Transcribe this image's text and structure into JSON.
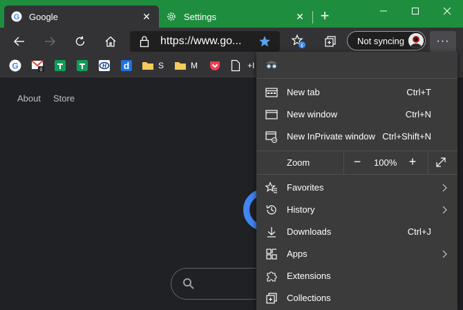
{
  "tabs": [
    {
      "label": "Google",
      "icon": "google-icon"
    },
    {
      "label": "Settings",
      "icon": "gear-icon"
    }
  ],
  "address_bar": {
    "url": "https://www.go..."
  },
  "profile": {
    "sync_label": "Not syncing"
  },
  "more_menu_label": "···",
  "favorites_bar": [
    {
      "icon": "google-icon"
    },
    {
      "icon": "gmail-icon"
    },
    {
      "icon": "sheets-icon"
    },
    {
      "icon": "sheets-icon"
    },
    {
      "icon": "hyundai-icon"
    },
    {
      "icon": "d-icon"
    },
    {
      "label": "S",
      "icon": "folder-icon"
    },
    {
      "label": "M",
      "icon": "folder-icon"
    },
    {
      "icon": "pocket-icon"
    },
    {
      "icon": "page-icon"
    },
    {
      "label": "+I",
      "icon": "page-icon"
    }
  ],
  "page": {
    "links": [
      "About",
      "Store"
    ]
  },
  "menu": {
    "items_top": [
      {
        "label": "New tab",
        "shortcut": "Ctrl+T",
        "icon": "new-tab-icon"
      },
      {
        "label": "New window",
        "shortcut": "Ctrl+N",
        "icon": "new-window-icon"
      },
      {
        "label": "New InPrivate window",
        "shortcut": "Ctrl+Shift+N",
        "icon": "inprivate-window-icon"
      }
    ],
    "zoom": {
      "label": "Zoom",
      "value": "100%",
      "minus": "−",
      "plus": "+"
    },
    "items_bottom": [
      {
        "label": "Favorites",
        "shortcut": "",
        "icon": "favorites-icon",
        "submenu": true
      },
      {
        "label": "History",
        "shortcut": "",
        "icon": "history-icon",
        "submenu": true
      },
      {
        "label": "Downloads",
        "shortcut": "Ctrl+J",
        "icon": "download-icon",
        "submenu": false
      },
      {
        "label": "Apps",
        "shortcut": "",
        "icon": "apps-icon",
        "submenu": true
      },
      {
        "label": "Extensions",
        "shortcut": "",
        "icon": "extensions-icon",
        "submenu": false
      },
      {
        "label": "Collections",
        "shortcut": "",
        "icon": "collections-icon",
        "submenu": false
      }
    ]
  },
  "colors": {
    "titlebar": "#1e8e3e",
    "toolbar": "#333336",
    "menu": "#3b3b3b",
    "accent": "#3b8eea"
  }
}
